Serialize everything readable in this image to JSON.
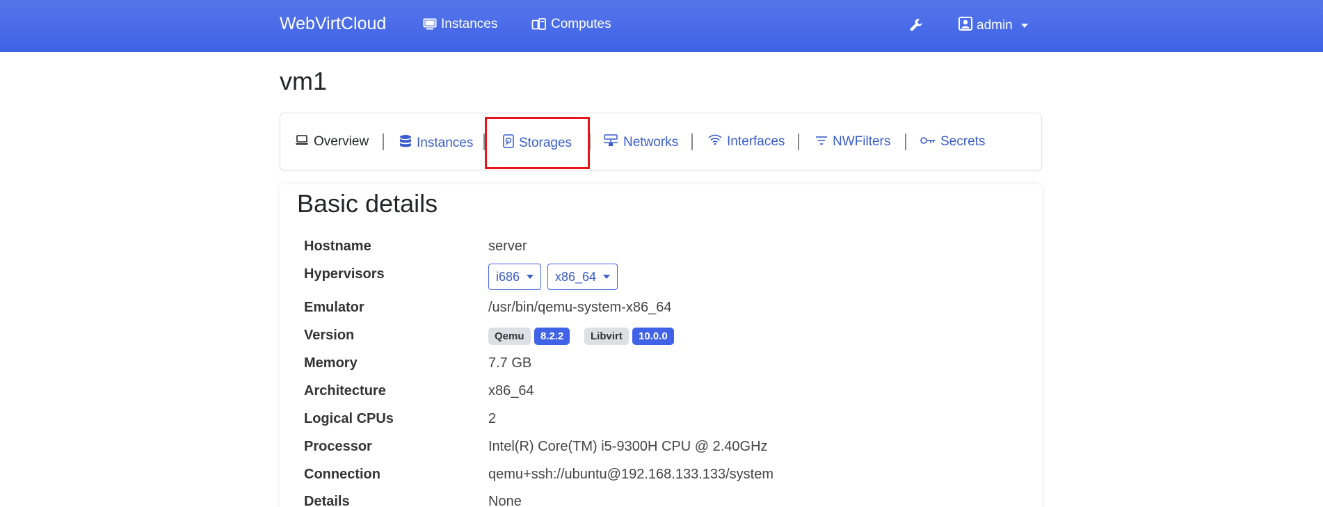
{
  "navbar": {
    "brand": "WebVirtCloud",
    "links": [
      {
        "label": "Instances",
        "icon": "monitor-icon"
      },
      {
        "label": "Computes",
        "icon": "computes-icon"
      }
    ],
    "settings_icon": "wrench-icon",
    "user": {
      "label": "admin",
      "icon": "user-icon"
    }
  },
  "page": {
    "title": "vm1"
  },
  "tabs": [
    {
      "label": "Overview",
      "icon": "laptop-icon",
      "active": true
    },
    {
      "label": "Instances",
      "icon": "database-icon"
    },
    {
      "label": "Storages",
      "icon": "hdd-icon"
    },
    {
      "label": "Networks",
      "icon": "network-icon"
    },
    {
      "label": "Interfaces",
      "icon": "wifi-icon"
    },
    {
      "label": "NWFilters",
      "icon": "filter-icon"
    },
    {
      "label": "Secrets",
      "icon": "key-icon"
    }
  ],
  "details": {
    "title": "Basic details",
    "hostname": {
      "label": "Hostname",
      "value": "server"
    },
    "hypervisors": {
      "label": "Hypervisors",
      "options": [
        "i686",
        "x86_64"
      ]
    },
    "emulator": {
      "label": "Emulator",
      "value": "/usr/bin/qemu-system-x86_64"
    },
    "version": {
      "label": "Version",
      "qemu_label": "Qemu",
      "qemu_version": "8.2.2",
      "libvirt_label": "Libvirt",
      "libvirt_version": "10.0.0"
    },
    "memory": {
      "label": "Memory",
      "value": "7.7 GB"
    },
    "architecture": {
      "label": "Architecture",
      "value": "x86_64"
    },
    "cpus": {
      "label": "Logical CPUs",
      "value": "2"
    },
    "processor": {
      "label": "Processor",
      "value": "Intel(R) Core(TM) i5-9300H CPU @ 2.40GHz"
    },
    "connection": {
      "label": "Connection",
      "value": "qemu+ssh://ubuntu@192.168.133.133/system"
    },
    "details_row": {
      "label": "Details",
      "value": "None"
    }
  },
  "colors": {
    "accent": "#3f62e6",
    "highlight": "#e8141a"
  }
}
